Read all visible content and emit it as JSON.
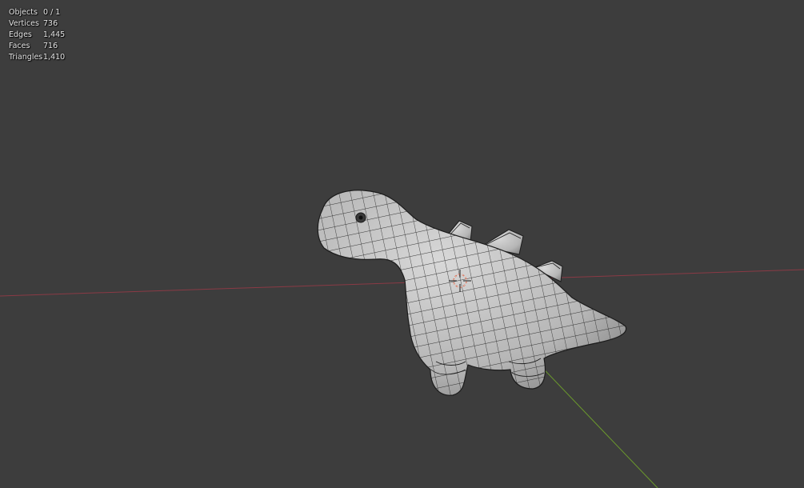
{
  "viewport": {
    "background_color": "#3d3d3d",
    "axis_x_color": "#8a3a45",
    "axis_y_color": "#6b9a2c",
    "mesh_color": "#c4c4c4",
    "wire_color": "#1c1c1c",
    "cursor_color": "#d66a4f"
  },
  "stats": {
    "objects": {
      "label": "Objects",
      "value": "0 / 1"
    },
    "vertices": {
      "label": "Vertices",
      "value": "736"
    },
    "edges": {
      "label": "Edges",
      "value": "1,445"
    },
    "faces": {
      "label": "Faces",
      "value": "716"
    },
    "triangles": {
      "label": "Triangles",
      "value": "1,410"
    }
  },
  "scene": {
    "object_name_icon": "dinosaur-mesh",
    "cursor_icon": "3d-cursor-icon"
  }
}
